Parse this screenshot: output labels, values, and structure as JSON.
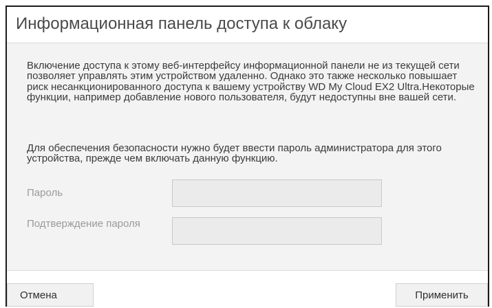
{
  "dialog": {
    "title": "Информационная панель доступа к облаку",
    "paragraph1": "Включение доступа к этому веб-интерфейсу информационной панели не из текущей сети позволяет управлять этим устройством удаленно. Однако это также несколько повышает риск несанкционированного доступа к вашему устройству WD My Cloud EX2 Ultra.Некоторые функции, например добавление нового пользователя, будут недоступны вне вашей сети.",
    "paragraph2": "Для обеспечения безопасности нужно будет ввести пароль администратора для этого устройства, прежде чем включать данную функцию.",
    "fields": {
      "password_label": "Пароль",
      "password_value": "",
      "confirm_label": "Подтверждение пароля",
      "confirm_value": ""
    },
    "buttons": {
      "cancel_label": "Отмена",
      "apply_label": "Применить"
    }
  },
  "colors": {
    "title_text": "#4a4a4a",
    "body_background": "#f3f3f3",
    "label_text": "#9a9a9a",
    "input_background": "#ebebeb",
    "button_background": "#f1f1f1"
  }
}
